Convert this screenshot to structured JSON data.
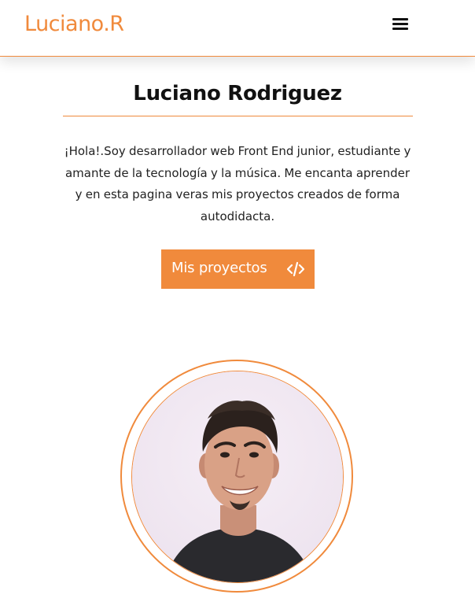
{
  "header": {
    "logo": "Luciano.R",
    "menu_icon": "hamburger-menu-icon"
  },
  "hero": {
    "name": "Luciano Rodriguez",
    "intro": "¡Hola!.Soy desarrollador web Front End junior, estudiante y amante de la tecnología y la música. Me encanta aprender y en esta pagina veras mis proyectos creados de forma autodidacta.",
    "cta_label": "Mis proyectos",
    "cta_icon": "code-icon"
  },
  "profile": {
    "photo_icon": "profile-photo"
  },
  "colors": {
    "accent": "#f08a3c",
    "text": "#111111",
    "background": "#ffffff"
  }
}
